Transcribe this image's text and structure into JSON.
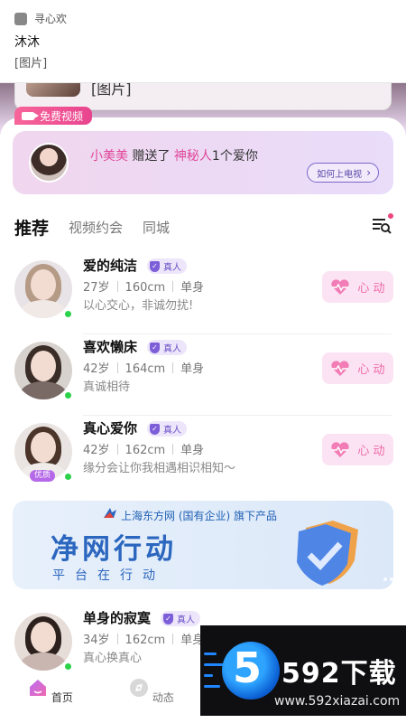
{
  "notification": {
    "app_name": "寻心欢",
    "title": "沐沐",
    "message": "[图片]"
  },
  "back_card": {
    "text": "[图片]"
  },
  "video_tag": {
    "label": "免费视频"
  },
  "gift_banner": {
    "sender": "小美美",
    "action": "赠送了",
    "receiver": "神秘人",
    "item": "1个爱你",
    "button": "如何上电视"
  },
  "tabs": [
    {
      "label": "推荐",
      "active": true
    },
    {
      "label": "视频约会",
      "active": false
    },
    {
      "label": "同城",
      "active": false
    }
  ],
  "verified_label": "真人",
  "like_label": "心 动",
  "users": [
    {
      "name": "爱的纯洁",
      "age": "27岁",
      "height": "160cm",
      "status": "单身",
      "bio": "以心交心，非诚勿扰!",
      "online": true
    },
    {
      "name": "喜欢懒床",
      "age": "42岁",
      "height": "164cm",
      "status": "单身",
      "bio": "真诚相待",
      "online": true
    },
    {
      "name": "真心爱你",
      "age": "42岁",
      "height": "162cm",
      "status": "单身",
      "bio": "缘分会让你我相遇相识相知～",
      "online": true,
      "tag": "优质"
    },
    {
      "name": "单身的寂寞",
      "age": "34岁",
      "height": "162cm",
      "status": "单身",
      "bio": "真心换真心",
      "online": true
    }
  ],
  "ad_banner": {
    "top_text": "上海东方网 (国有企业) 旗下产品",
    "title": "净网行动",
    "subtitle": "平台在行动"
  },
  "bottom_nav": [
    {
      "label": "首页",
      "icon": "home-icon",
      "active": true
    },
    {
      "label": "动态",
      "icon": "moments-icon",
      "active": false
    }
  ],
  "watermark": {
    "brand": "592下载",
    "number": "5",
    "url": "www.592xiazai.com"
  },
  "colors": {
    "accent_pink": "#e0469a",
    "verified_purple": "#6a4fc6",
    "online_green": "#2bd24a",
    "ad_blue": "#2b66bf"
  }
}
